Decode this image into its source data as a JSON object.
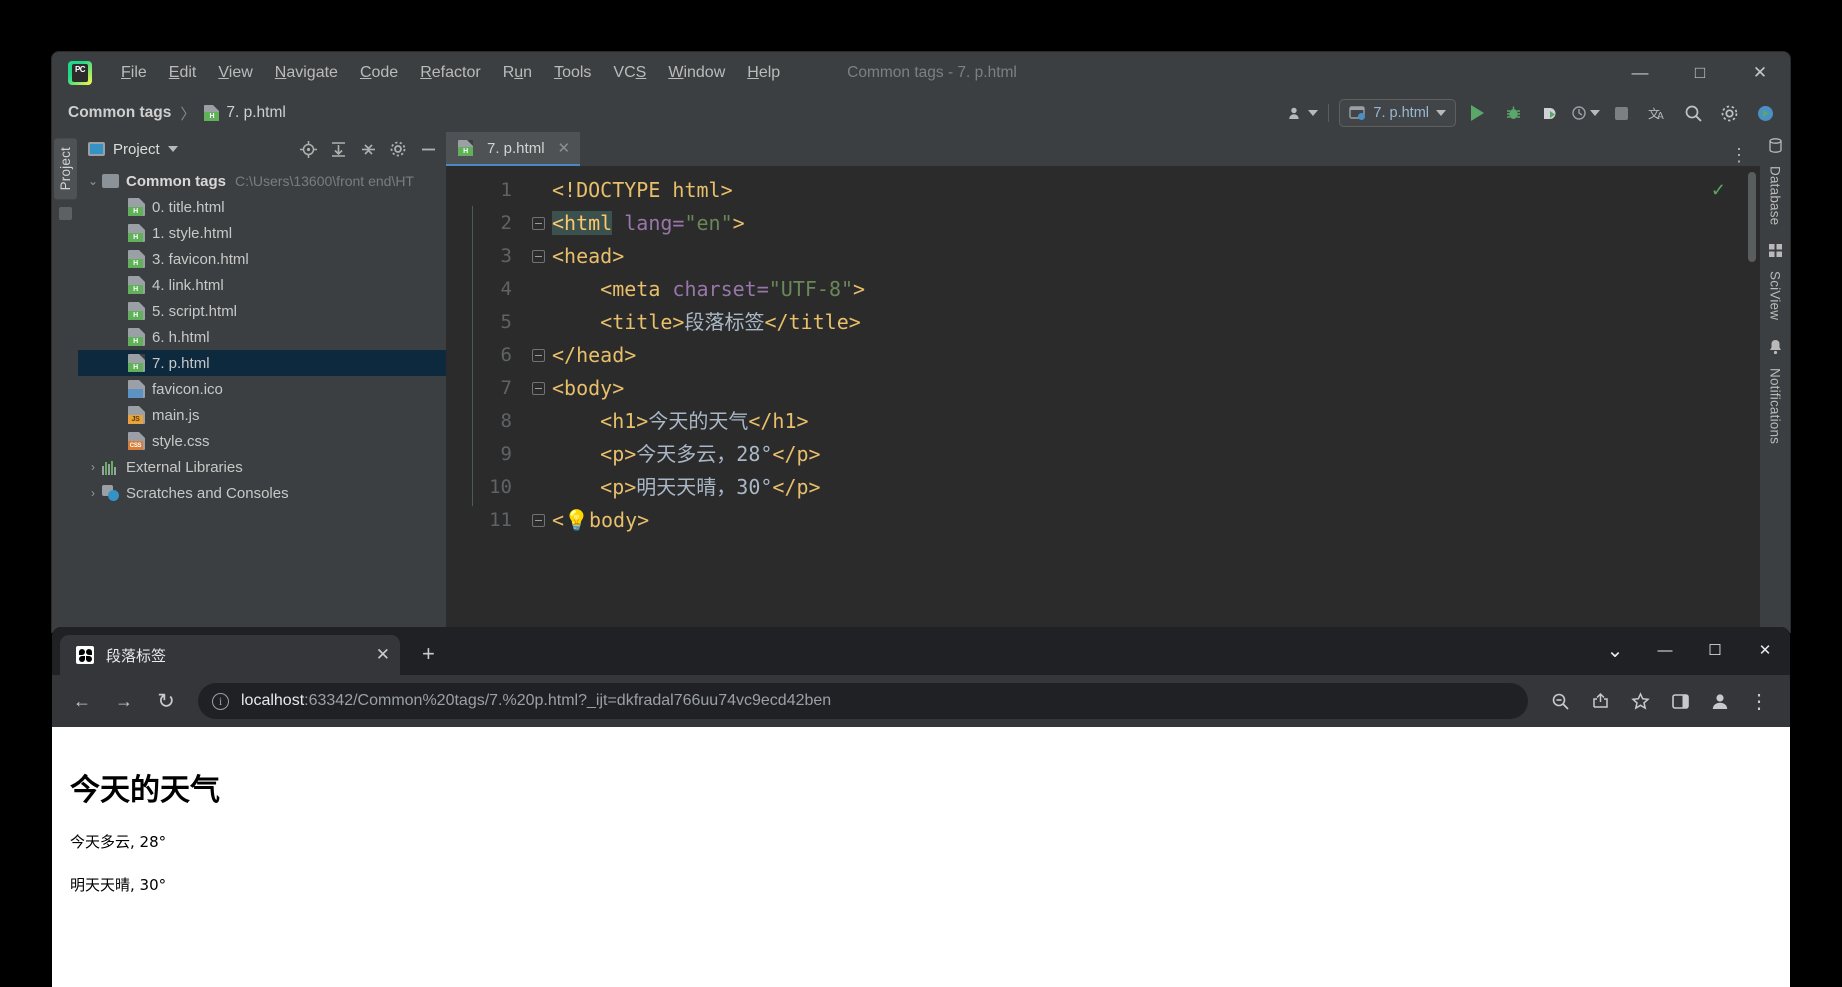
{
  "ide": {
    "window_title": "Common tags - 7. p.html",
    "menu": [
      {
        "label": "File",
        "mnemonic": "F"
      },
      {
        "label": "Edit",
        "mnemonic": "E"
      },
      {
        "label": "View",
        "mnemonic": "V"
      },
      {
        "label": "Navigate",
        "mnemonic": "N"
      },
      {
        "label": "Code",
        "mnemonic": "C"
      },
      {
        "label": "Refactor",
        "mnemonic": "R"
      },
      {
        "label": "Run",
        "mnemonic": "u"
      },
      {
        "label": "Tools",
        "mnemonic": "T"
      },
      {
        "label": "VCS",
        "mnemonic": "S"
      },
      {
        "label": "Window",
        "mnemonic": "W"
      },
      {
        "label": "Help",
        "mnemonic": "H"
      }
    ],
    "window_controls": {
      "minimize": "—",
      "maximize": "□",
      "close": "✕"
    },
    "breadcrumb": {
      "project": "Common tags",
      "separator": "〉",
      "file": "7. p.html"
    },
    "run_config": {
      "name": "7. p.html"
    },
    "toolbar_icons": [
      "user-icon",
      "run-icon",
      "debug-icon",
      "coverage-icon",
      "profiler-icon",
      "stop-icon",
      "translate-icon",
      "search-icon",
      "settings-icon",
      "updates-icon"
    ],
    "project_panel": {
      "title": "Project",
      "header_icons": [
        "locate-icon",
        "expand-all-icon",
        "collapse-all-icon",
        "settings-gear-icon",
        "hide-icon",
        "more-icon"
      ],
      "tree": [
        {
          "label": "Common tags",
          "path": "C:\\Users\\13600\\front end\\HT",
          "type": "folder",
          "depth": 0,
          "expanded": true,
          "bold": true
        },
        {
          "label": "0. title.html",
          "type": "html",
          "depth": 1
        },
        {
          "label": "1. style.html",
          "type": "html",
          "depth": 1
        },
        {
          "label": "3. favicon.html",
          "type": "html",
          "depth": 1
        },
        {
          "label": "4. link.html",
          "type": "html",
          "depth": 1
        },
        {
          "label": "5. script.html",
          "type": "html",
          "depth": 1
        },
        {
          "label": "6. h.html",
          "type": "html",
          "depth": 1
        },
        {
          "label": "7. p.html",
          "type": "html",
          "depth": 1,
          "selected": true
        },
        {
          "label": "favicon.ico",
          "type": "image",
          "depth": 1
        },
        {
          "label": "main.js",
          "type": "js",
          "depth": 1
        },
        {
          "label": "style.css",
          "type": "css",
          "depth": 1
        },
        {
          "label": "External Libraries",
          "type": "libraries",
          "depth": 0,
          "expanded": false
        },
        {
          "label": "Scratches and Consoles",
          "type": "scratches",
          "depth": 0,
          "expanded": false
        }
      ]
    },
    "editor": {
      "tab": {
        "label": "7. p.html",
        "close": "✕"
      },
      "inspection_status": "✓",
      "lines": [
        {
          "n": 1,
          "fold": false,
          "tokens": [
            {
              "t": "tag",
              "v": "<!DOCTYPE html>"
            }
          ]
        },
        {
          "n": 2,
          "fold": true,
          "tokens": [
            {
              "t": "hl",
              "v": "<html"
            },
            {
              "t": "attr",
              "v": " lang="
            },
            {
              "t": "str",
              "v": "\"en\""
            },
            {
              "t": "tag",
              "v": ">"
            }
          ]
        },
        {
          "n": 3,
          "fold": true,
          "tokens": [
            {
              "t": "tag",
              "v": "<head>"
            }
          ]
        },
        {
          "n": 4,
          "fold": false,
          "tokens": [
            {
              "t": "tag",
              "v": "    <meta"
            },
            {
              "t": "attr",
              "v": " charset="
            },
            {
              "t": "str",
              "v": "\"UTF-8\""
            },
            {
              "t": "tag",
              "v": ">"
            }
          ]
        },
        {
          "n": 5,
          "fold": false,
          "tokens": [
            {
              "t": "tag",
              "v": "    <title>"
            },
            {
              "t": "txt",
              "v": "段落标签"
            },
            {
              "t": "tag",
              "v": "</title>"
            }
          ]
        },
        {
          "n": 6,
          "fold": true,
          "tokens": [
            {
              "t": "tag",
              "v": "</head>"
            }
          ]
        },
        {
          "n": 7,
          "fold": true,
          "tokens": [
            {
              "t": "tag",
              "v": "<body>"
            }
          ]
        },
        {
          "n": 8,
          "fold": false,
          "tokens": [
            {
              "t": "tag",
              "v": "    <h1>"
            },
            {
              "t": "txt",
              "v": "今天的天气"
            },
            {
              "t": "tag",
              "v": "</h1>"
            }
          ]
        },
        {
          "n": 9,
          "fold": false,
          "tokens": [
            {
              "t": "tag",
              "v": "    <p>"
            },
            {
              "t": "txt",
              "v": "今天多云，28°"
            },
            {
              "t": "tag",
              "v": "</p>"
            }
          ]
        },
        {
          "n": 10,
          "fold": false,
          "tokens": [
            {
              "t": "tag",
              "v": "    <p>"
            },
            {
              "t": "txt",
              "v": "明天天晴，30°"
            },
            {
              "t": "tag",
              "v": "</p>"
            }
          ]
        },
        {
          "n": 11,
          "fold": true,
          "tokens": [
            {
              "t": "tag",
              "v": "<"
            },
            {
              "t": "txt",
              "v": "💡"
            },
            {
              "t": "tag",
              "v": "body>"
            }
          ]
        }
      ]
    },
    "left_rail": {
      "project_tab": "Project"
    },
    "right_rail": {
      "items": [
        "Database",
        "SciView",
        "Notifications"
      ]
    }
  },
  "browser": {
    "tab": {
      "title": "段落标签",
      "close": "✕"
    },
    "new_tab": "+",
    "window_controls": {
      "minimize_chevron": "⌄",
      "minimize": "—",
      "maximize": "☐",
      "close": "✕"
    },
    "nav": {
      "back": "←",
      "forward": "→",
      "reload": "↻"
    },
    "omnibox": {
      "info_icon": "i",
      "url_host": "localhost",
      "url_rest": ":63342/Common%20tags/7.%20p.html?_ijt=dkfradal766uu74vc9ecd42ben"
    },
    "toolbar_right_icons": [
      "zoom-icon",
      "share-icon",
      "bookmark-star-icon",
      "side-panel-icon",
      "profile-icon",
      "chrome-menu-icon"
    ],
    "page": {
      "h1": "今天的天气",
      "p1": "今天多云, 28°",
      "p2": "明天天晴, 30°"
    }
  },
  "colors": {
    "ide_chrome": "#3c3f41",
    "editor_bg": "#2b2b2b",
    "selection_blue": "#0d293e",
    "accent_green": "#59a869",
    "tag_orange": "#e8bf6a",
    "string_green": "#6a8759",
    "attr_purple": "#9876aa",
    "browser_chrome": "#35363a",
    "browser_dark": "#202124"
  }
}
